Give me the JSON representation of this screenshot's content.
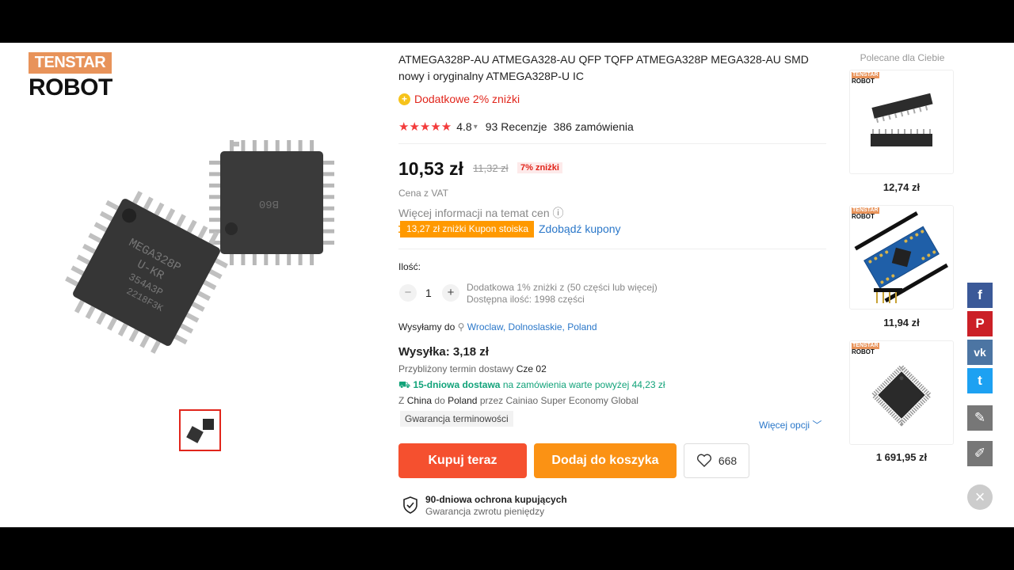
{
  "logo": {
    "line1": "TENSTAR",
    "line2": "ROBOT"
  },
  "product": {
    "title": "ATMEGA328P-AU ATMEGA328-AU QFP TQFP ATMEGA328P MEGA328-AU SMD nowy i oryginalny ATMEGA328P-U IC",
    "extra_discount_icon": "+",
    "extra_discount": "Dodatkowe 2% zniżki",
    "stars": "★★★★★",
    "rating": "4.8",
    "reviews": "93 Recenzje",
    "orders": "386 zamówienia",
    "chip_marks": {
      "chip1": "MEGA328P",
      "chip1_l2": "U-KR",
      "chip1_l3": "354A3P",
      "chip1_l4": "2218F3K",
      "chip2": "B60"
    }
  },
  "pricing": {
    "price": "10,53 zł",
    "old_price": "11,32 zł",
    "discount_badge": "7% zniżki",
    "vat_note": "Cena z VAT",
    "more_info": "Więcej informacji na temat cen ⓘ",
    "coupon": "13,27 zł zniżki Kupon stoiska",
    "get_coupons": "Zdobądź kupony"
  },
  "quantity": {
    "label": "Ilość:",
    "minus": "−",
    "value": "1",
    "plus": "+",
    "bulk_note": "Dodatkowa 1% zniżki z (50 części lub więcej)",
    "available": "Dostępna ilość: 1998 części"
  },
  "shipping": {
    "ship_to_label": "Wysyłamy do",
    "location": "Wroclaw, Dolnoslaskie, Poland",
    "cost": "Wysyłka: 3,18 zł",
    "delivery_label": "Przybliżony termin dostawy",
    "delivery_date": "Cze 02",
    "fast_label": "15-dniowa dostawa",
    "fast_note": "na zamówienia warte powyżej 44,23 zł",
    "route_z": "Z",
    "route_from": "China",
    "route_do": "do",
    "route_to": "Poland",
    "route_via": "przez Cainiao Super Economy Global",
    "guarantee_chip": "Gwarancja terminowości",
    "more_options": "Więcej opcji ﹀"
  },
  "actions": {
    "buy_now": "Kupuj teraz",
    "add_to_cart": "Dodaj do koszyka",
    "wishlist_count": "668"
  },
  "protection": {
    "title": "90-dniowa ochrona kupujących",
    "subtitle": "Gwarancja zwrotu pieniędzy"
  },
  "recommended": {
    "title": "Polecane dla Ciebie",
    "items": [
      {
        "price": "12,74 zł",
        "logo_top": "TENSTAR",
        "logo_bot": "ROBOT"
      },
      {
        "price": "11,94 zł",
        "logo_top": "TENSTAR",
        "logo_bot": "ROBOT"
      },
      {
        "price": "1 691,95 zł",
        "logo_top": "TENSTAR",
        "logo_bot": "ROBOT"
      }
    ]
  },
  "social": {
    "facebook": "f",
    "pinterest": "P",
    "vk": "vk",
    "twitter": "t",
    "edit": "✎",
    "pencil": "✐",
    "close": "×",
    "colors": {
      "facebook": "#3b5998",
      "pinterest": "#cb2027",
      "vk": "#4c75a3",
      "twitter": "#1da1f2",
      "edit": "#777777",
      "pencil": "#777777"
    }
  },
  "colors": {
    "accent_red": "#f5502f",
    "accent_orange": "#fb9214",
    "link": "#2a77c9",
    "green": "#12a37a"
  }
}
